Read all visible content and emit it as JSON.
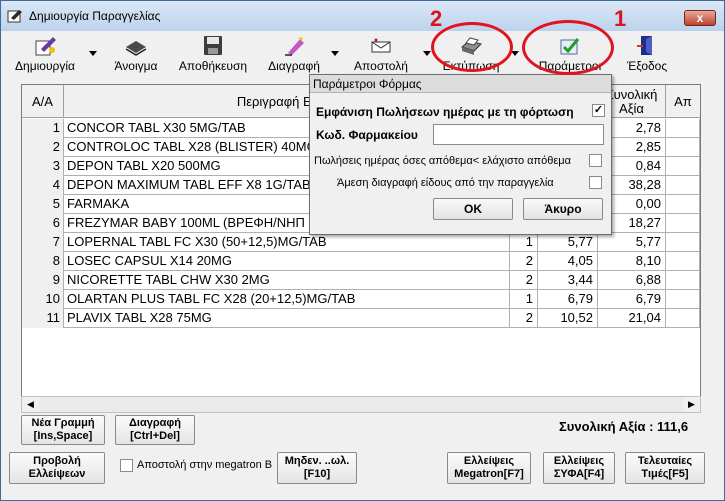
{
  "window": {
    "title": "Δημιουργία Παραγγελίας",
    "close_label": "x"
  },
  "toolbar": {
    "create": "Δημιουργία",
    "open": "Άνοιγμα",
    "save": "Αποθήκευση",
    "delete": "Διαγραφή",
    "send": "Αποστολή",
    "print": "Εκτύπωση",
    "params": "Παράμετροι",
    "exit": "Έξοδος"
  },
  "grid": {
    "headers": {
      "aa": "Α/Α",
      "desc": "Περιγραφή Είδου",
      "total": "Συνολική Αξία",
      "next": "Απ"
    },
    "rows": [
      {
        "n": "1",
        "desc": "CONCOR TABL X30 5MG/TAB",
        "qty": "",
        "price": "",
        "total": "2,78"
      },
      {
        "n": "2",
        "desc": "CONTROLOC TABL X28 (BLISTER) 40MG",
        "qty": "",
        "price": "",
        "total": "2,85"
      },
      {
        "n": "3",
        "desc": "DEPON TABL X20 500MG",
        "qty": "",
        "price": "",
        "total": "0,84"
      },
      {
        "n": "4",
        "desc": "DEPON MAXIMUM TABL EFF X8 1G/TAB",
        "qty": "",
        "price": "",
        "total": "38,28"
      },
      {
        "n": "5",
        "desc": "FARMAKA",
        "qty": "",
        "price": "",
        "total": "0,00"
      },
      {
        "n": "6",
        "desc": "FREZYMAR BABY 100ML (ΒΡΕΦΗ/ΝΗΠ",
        "qty": "",
        "price": "",
        "total": "18,27"
      },
      {
        "n": "7",
        "desc": "LOPERNAL TABL FC X30 (50+12,5)MG/TAB",
        "qty": "1",
        "price": "5,77",
        "total": "5,77"
      },
      {
        "n": "8",
        "desc": "LOSEC CAPSUL X14 20MG",
        "qty": "2",
        "price": "4,05",
        "total": "8,10"
      },
      {
        "n": "9",
        "desc": "NICORETTE TABL CHW X30 2MG",
        "qty": "2",
        "price": "3,44",
        "total": "6,88"
      },
      {
        "n": "10",
        "desc": "OLARTAN PLUS TABL FC X28 (20+12,5)MG/TAB",
        "qty": "1",
        "price": "6,79",
        "total": "6,79"
      },
      {
        "n": "11",
        "desc": "PLAVIX TABL X28 75MG",
        "qty": "2",
        "price": "10,52",
        "total": "21,04"
      }
    ]
  },
  "dialog": {
    "title": "Παράμετροι Φόρμας",
    "show_sales_label": "Εμφάνιση Πωλήσεων ημέρας με τη φόρτωση",
    "show_sales_checked": "✓",
    "pharmacy_code_label": "Κωδ. Φαρμακείου",
    "pharmacy_code_value": "",
    "min_stock_label": "Πωλήσεις ημέρας όσες απόθεμα< ελάχιστο απόθεμα",
    "min_stock_checked": "",
    "direct_delete_label": "Άμεση διαγραφή είδους από την παραγγελία",
    "direct_delete_checked": "",
    "ok": "ΟΚ",
    "cancel": "Άκυρο"
  },
  "bottom": {
    "new_line": "Νέα Γραμμή [Ins,Space]",
    "delete_line": "Διαγραφή [Ctrl+Del]",
    "total": "Συνολική Αξία : 111,6",
    "show_shortages": "Προβολή Ελλείψεων",
    "megatron_send": "Αποστολή στην megatron B",
    "zero": "Μηδεν. ..ωλ.[F10]",
    "shortages_megatron": "Ελλείψεις Megatron[F7]",
    "shortages_syfa": "Ελλείψεις ΣΥΦΑ[F4]",
    "last_prices": "Τελευταίες Τιμές[F5]"
  },
  "annotations": {
    "one": "1",
    "two": "2",
    "color": "#e0141e"
  }
}
